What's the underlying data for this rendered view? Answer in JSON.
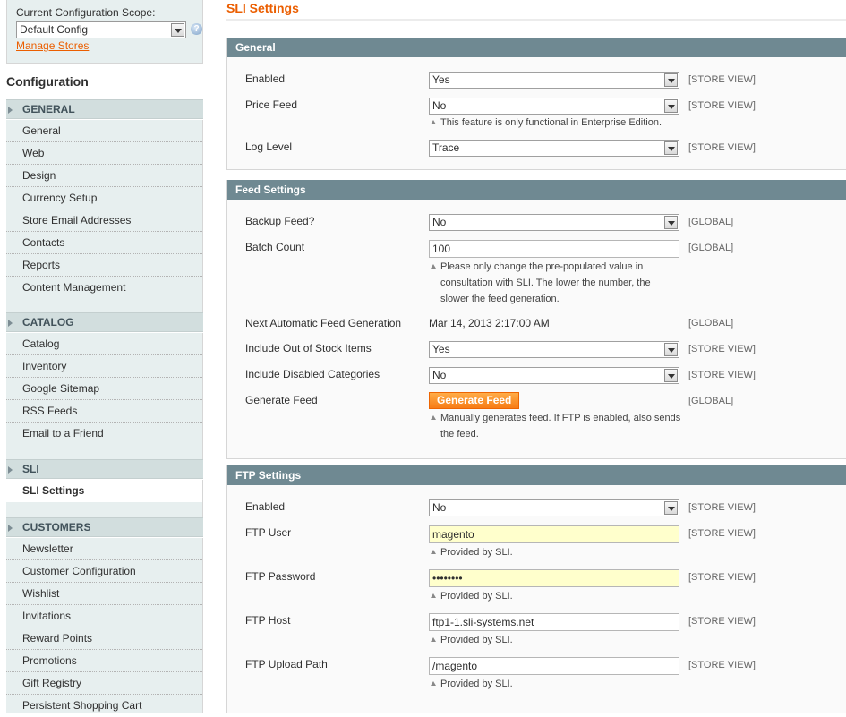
{
  "sidebar": {
    "scope_label": "Current Configuration Scope:",
    "scope_value": "Default Config",
    "manage_stores": "Manage Stores",
    "config_title": "Configuration",
    "groups": [
      {
        "title": "GENERAL",
        "items": [
          "General",
          "Web",
          "Design",
          "Currency Setup",
          "Store Email Addresses",
          "Contacts",
          "Reports",
          "Content Management"
        ]
      },
      {
        "title": "CATALOG",
        "items": [
          "Catalog",
          "Inventory",
          "Google Sitemap",
          "RSS Feeds",
          "Email to a Friend"
        ]
      },
      {
        "title": "SLI",
        "items": [
          "SLI Settings"
        ]
      },
      {
        "title": "CUSTOMERS",
        "items": [
          "Newsletter",
          "Customer Configuration",
          "Wishlist",
          "Invitations",
          "Reward Points",
          "Promotions",
          "Gift Registry",
          "Persistent Shopping Cart"
        ]
      }
    ]
  },
  "page": {
    "title": "SLI Settings"
  },
  "general": {
    "title": "General",
    "enabled": {
      "label": "Enabled",
      "value": "Yes",
      "scope": "[STORE VIEW]"
    },
    "price_feed": {
      "label": "Price Feed",
      "value": "No",
      "scope": "[STORE VIEW]",
      "note": "This feature is only functional in Enterprise Edition."
    },
    "log_level": {
      "label": "Log Level",
      "value": "Trace",
      "scope": "[STORE VIEW]"
    }
  },
  "feed": {
    "title": "Feed Settings",
    "backup": {
      "label": "Backup Feed?",
      "value": "No",
      "scope": "[GLOBAL]"
    },
    "batch": {
      "label": "Batch Count",
      "value": "100",
      "scope": "[GLOBAL]",
      "note_lines": [
        "Please only change the pre-populated value in",
        "consultation with SLI. The lower the number, the",
        "slower the feed generation."
      ]
    },
    "next": {
      "label": "Next Automatic Feed Generation",
      "value": "Mar 14, 2013 2:17:00 AM",
      "scope": "[GLOBAL]"
    },
    "oos": {
      "label": "Include Out of Stock Items",
      "value": "Yes",
      "scope": "[STORE VIEW]"
    },
    "disabled": {
      "label": "Include Disabled Categories",
      "value": "No",
      "scope": "[STORE VIEW]"
    },
    "generate": {
      "label": "Generate Feed",
      "button": "Generate Feed",
      "scope": "[GLOBAL]",
      "note_lines": [
        "Manually generates feed. If FTP is enabled, also sends",
        "the feed."
      ]
    }
  },
  "ftp": {
    "title": "FTP Settings",
    "enabled": {
      "label": "Enabled",
      "value": "No",
      "scope": "[STORE VIEW]"
    },
    "user": {
      "label": "FTP User",
      "value": "magento",
      "scope": "[STORE VIEW]",
      "note": "Provided by SLI."
    },
    "password": {
      "label": "FTP Password",
      "value": "••••••••",
      "scope": "[STORE VIEW]",
      "note": "Provided by SLI."
    },
    "host": {
      "label": "FTP Host",
      "value": "ftp1-1.sli-systems.net",
      "scope": "[STORE VIEW]",
      "note": "Provided by SLI."
    },
    "path": {
      "label": "FTP Upload Path",
      "value": "/magento",
      "scope": "[STORE VIEW]",
      "note": "Provided by SLI."
    }
  }
}
